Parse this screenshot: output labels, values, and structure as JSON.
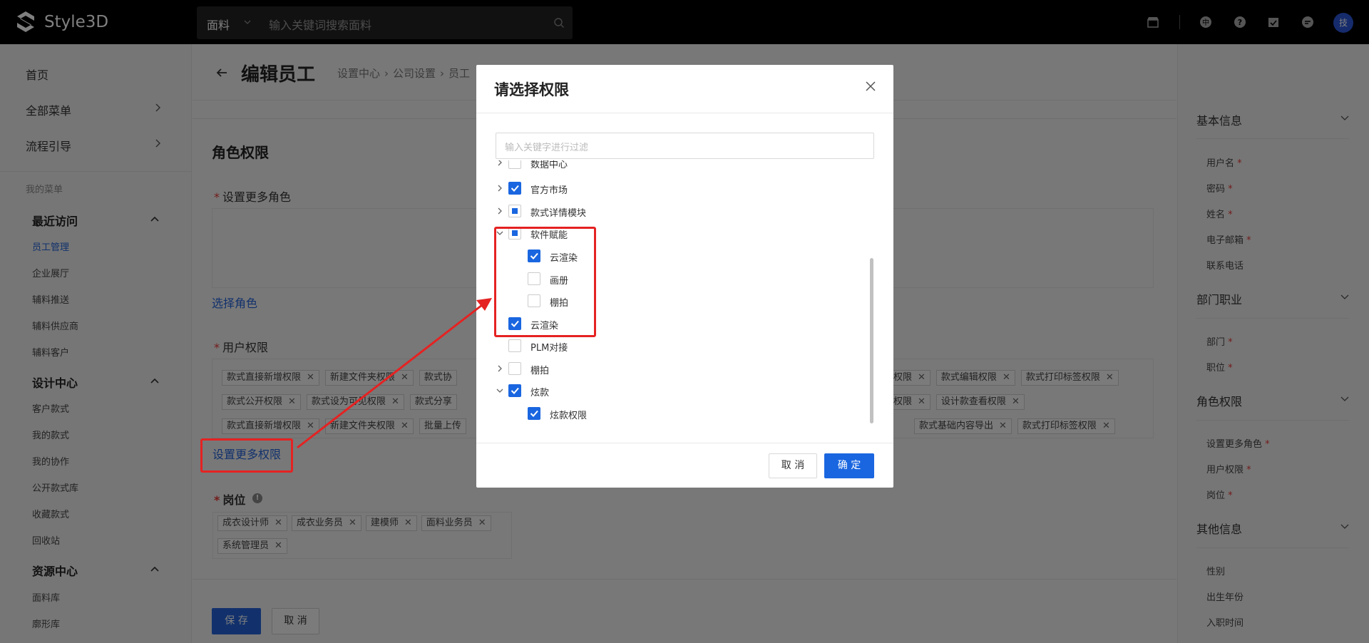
{
  "topbar": {
    "brand": "Style3D",
    "search_category": "面料",
    "search_placeholder": "输入关键词搜索面料",
    "avatar_text": "技"
  },
  "sidebar": {
    "top_items": [
      "首页",
      "全部菜单",
      "流程引导"
    ],
    "my_menu_caption": "我的菜单",
    "sections": [
      {
        "title": "最近访问",
        "items": [
          "员工管理",
          "企业展厅",
          "辅料推送",
          "辅料供应商",
          "辅料客户"
        ]
      },
      {
        "title": "设计中心",
        "items": [
          "客户款式",
          "我的款式",
          "我的协作",
          "公开款式库",
          "收藏款式",
          "回收站"
        ]
      },
      {
        "title": "资源中心",
        "items": [
          "面料库",
          "廓形库"
        ]
      }
    ]
  },
  "page": {
    "title": "编辑员工",
    "breadcrumbs": [
      "设置中心",
      "›",
      "公司设置",
      "›",
      "员工"
    ],
    "section_title": "角色权限",
    "more_roles_label": "设置更多角色",
    "select_role_link": "选择角色",
    "user_perm_label": "用户权限",
    "perm_tags_row1_left": [
      "款式直接新增权限",
      "新建文件夹权限",
      "款式协"
    ],
    "perm_tags_row1_right": [
      "权限",
      "款式编辑权限",
      "款式打印标签权限"
    ],
    "perm_tags_row2_left": [
      "款式公开权限",
      "款式设为可见权限",
      "款式分享"
    ],
    "perm_tags_row2_right": [
      "权限",
      "设计款查看权限"
    ],
    "perm_tags_row3_left": [
      "款式直接新增权限",
      "新建文件夹权限",
      "批量上传"
    ],
    "perm_tags_row3_right": [
      "款式基础内容导出",
      "款式打印标签权限"
    ],
    "more_perm_link": "设置更多权限",
    "position_label": "岗位",
    "position_info": "!",
    "position_tags": [
      "成衣设计师",
      "成衣业务员",
      "建模师",
      "面料业务员",
      "系统管理员"
    ],
    "save_button": "保 存",
    "cancel_button": "取 消"
  },
  "right_panel": {
    "sections": [
      {
        "title": "基本信息",
        "items": [
          {
            "label": "用户名",
            "required": "*"
          },
          {
            "label": "密码",
            "required": "*"
          },
          {
            "label": "姓名",
            "required": "*"
          },
          {
            "label": "电子邮箱",
            "required": "*"
          },
          {
            "label": "联系电话",
            "required": ""
          }
        ]
      },
      {
        "title": "部门职业",
        "items": [
          {
            "label": "部门",
            "required": "*"
          },
          {
            "label": "职位",
            "required": "*"
          }
        ]
      },
      {
        "title": "角色权限",
        "items": [
          {
            "label": "设置更多角色",
            "required": "*"
          },
          {
            "label": "用户权限",
            "required": "*"
          },
          {
            "label": "岗位",
            "required": "*"
          }
        ]
      },
      {
        "title": "其他信息",
        "items": [
          {
            "label": "性别",
            "required": ""
          },
          {
            "label": "出生年份",
            "required": ""
          },
          {
            "label": "入职时间",
            "required": ""
          }
        ]
      }
    ]
  },
  "modal": {
    "title": "请选择权限",
    "filter_placeholder": "输入关键字进行过滤",
    "tree": [
      {
        "label": "数据中心",
        "level": 0,
        "arrow": "right",
        "state": "unchecked"
      },
      {
        "label": "官方市场",
        "level": 0,
        "arrow": "right",
        "state": "checked"
      },
      {
        "label": "款式详情模块",
        "level": 0,
        "arrow": "right",
        "state": "indeterminate"
      },
      {
        "label": "软件赋能",
        "level": 0,
        "arrow": "down",
        "state": "indeterminate"
      },
      {
        "label": "云渲染",
        "level": 1,
        "arrow": "none",
        "state": "checked"
      },
      {
        "label": "画册",
        "level": 1,
        "arrow": "none",
        "state": "unchecked"
      },
      {
        "label": "棚拍",
        "level": 1,
        "arrow": "none",
        "state": "unchecked"
      },
      {
        "label": "云渲染",
        "level": 0,
        "arrow": "none",
        "state": "checked"
      },
      {
        "label": "PLM对接",
        "level": 0,
        "arrow": "none",
        "state": "unchecked"
      },
      {
        "label": "棚拍",
        "level": 0,
        "arrow": "right",
        "state": "unchecked"
      },
      {
        "label": "炫款",
        "level": 0,
        "arrow": "down",
        "state": "checked"
      },
      {
        "label": "炫款权限",
        "level": 1,
        "arrow": "none",
        "state": "checked"
      }
    ],
    "cancel_button": "取 消",
    "ok_button": "确 定"
  },
  "colors": {
    "primary": "#1a66e0",
    "annotation_red": "#e52222",
    "topbar": "#000000"
  }
}
